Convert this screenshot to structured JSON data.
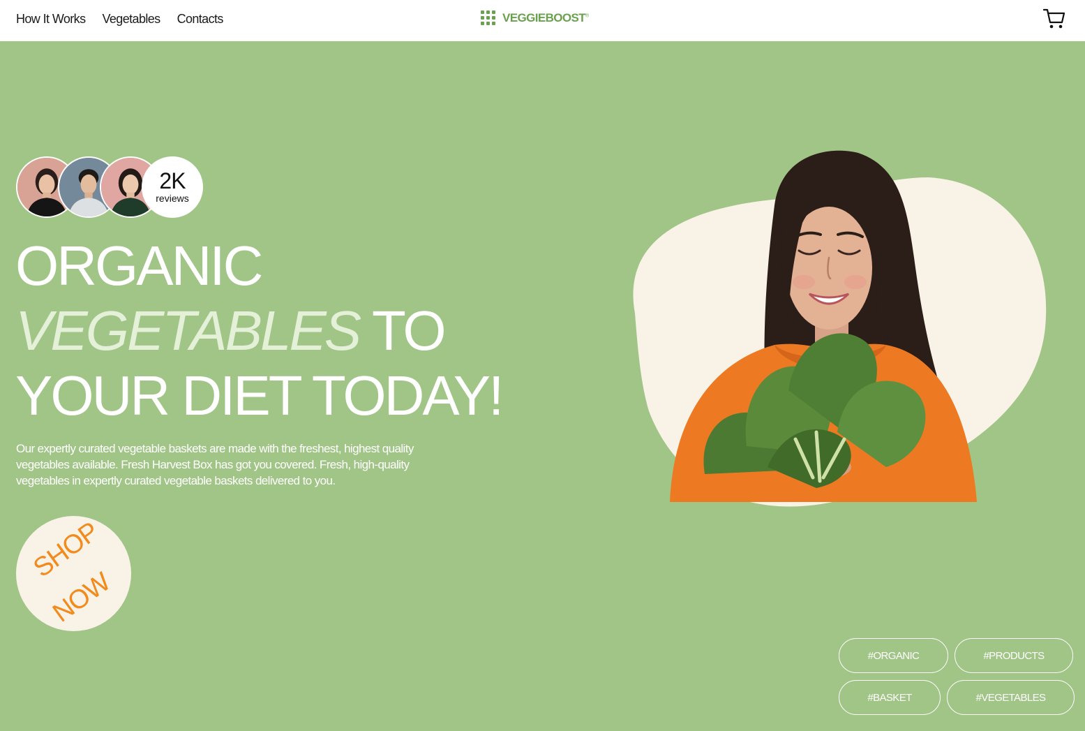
{
  "nav": {
    "items": [
      {
        "label": "How It Works"
      },
      {
        "label": "Vegetables"
      },
      {
        "label": "Contacts"
      }
    ]
  },
  "brand": {
    "name": "VEGGIEBOOST",
    "mark": "®",
    "icon": "grid-dots-icon",
    "color": "#6aa14e"
  },
  "cart": {
    "icon": "shopping-cart-icon"
  },
  "hero": {
    "background": "#a1c587",
    "reviews": {
      "count": "2K",
      "label": "reviews"
    },
    "headline": {
      "line1": "ORGANIC",
      "line2_accent": "VEGETABLES",
      "line2_rest": " TO",
      "line3": "YOUR DIET TODAY!"
    },
    "description": "Our expertly curated vegetable baskets are made with the freshest, highest quality vegetables available. Fresh Harvest Box has got you covered. Fresh, high-quality vegetables in expertly curated vegetable baskets delivered to you.",
    "cta": {
      "line1": "SHOP",
      "line2": "NOW",
      "color": "#f28a1c"
    },
    "tags": [
      "#ORGANIC",
      "#PRODUCTS",
      "#BASKET",
      "#VEGETABLES"
    ]
  }
}
